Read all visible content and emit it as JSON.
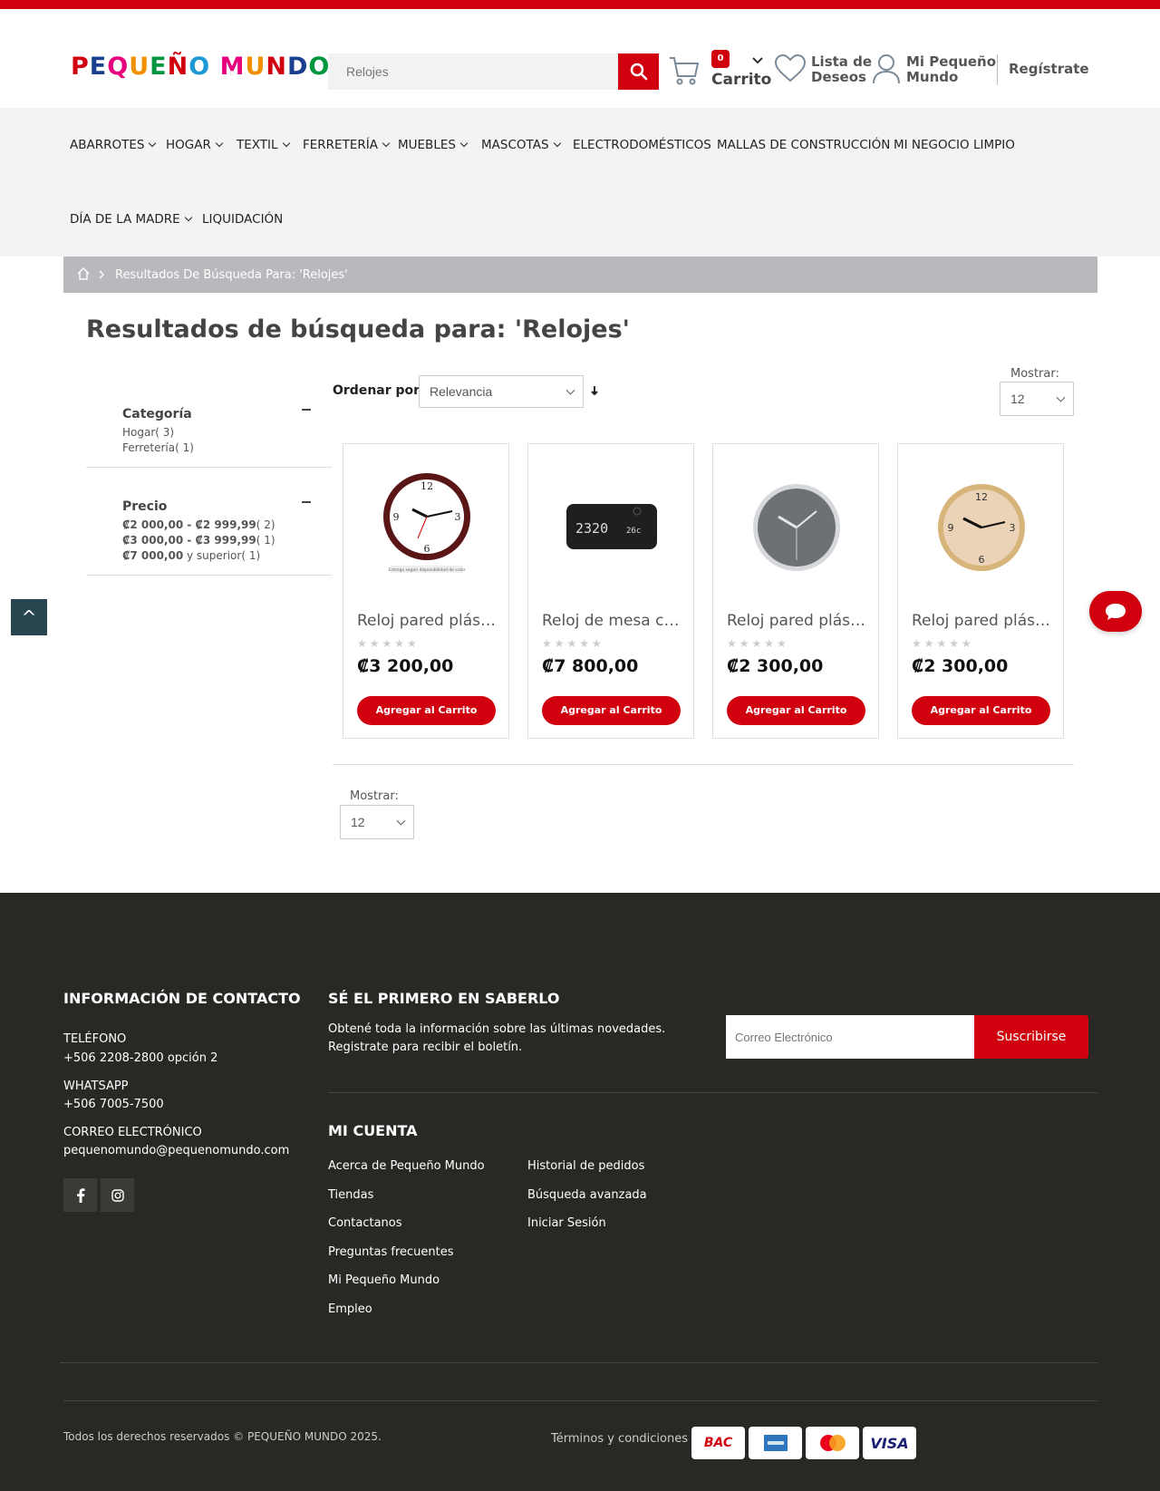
{
  "header": {
    "logo_letters": [
      {
        "ch": "P",
        "color": "#d0000f"
      },
      {
        "ch": "E",
        "color": "#1b3f8f"
      },
      {
        "ch": "Q",
        "color": "#e6007e"
      },
      {
        "ch": "U",
        "color": "#f29100"
      },
      {
        "ch": "E",
        "color": "#009640"
      },
      {
        "ch": "Ñ",
        "color": "#d0000f"
      },
      {
        "ch": "O",
        "color": "#1b9ad6"
      },
      {
        "ch": " ",
        "color": "#000"
      },
      {
        "ch": "M",
        "color": "#e6007e"
      },
      {
        "ch": "U",
        "color": "#f29100"
      },
      {
        "ch": "N",
        "color": "#d0000f"
      },
      {
        "ch": "D",
        "color": "#1b3f8f"
      },
      {
        "ch": "O",
        "color": "#009640"
      }
    ],
    "logo_text": "PEQUEÑO MUNDO",
    "search_value": "Relojes",
    "cart_count": "0",
    "cart_label": "Carrito",
    "wishlist_label": "Lista de Deseos",
    "account_label": "Mi Pequeño Mundo",
    "register_label": "Regístrate"
  },
  "nav": {
    "items": [
      {
        "label": "ABARROTES",
        "dropdown": true
      },
      {
        "label": "HOGAR",
        "dropdown": true
      },
      {
        "label": "TEXTIL",
        "dropdown": true
      },
      {
        "label": "FERRETERÍA",
        "dropdown": true
      },
      {
        "label": "MUEBLES",
        "dropdown": true
      },
      {
        "label": "MASCOTAS",
        "dropdown": true
      },
      {
        "label": "ELECTRODOMÉSTICOS",
        "dropdown": false
      },
      {
        "label": "MALLAS DE CONSTRUCCIÓN",
        "dropdown": false
      },
      {
        "label": "MI NEGOCIO LIMPIO",
        "dropdown": false
      },
      {
        "label": "DÍA DE LA MADRE",
        "dropdown": true
      },
      {
        "label": "LIQUIDACIÓN",
        "dropdown": false
      }
    ]
  },
  "breadcrumb": {
    "current": "Resultados De Búsqueda Para: 'Relojes'"
  },
  "page": {
    "title": "Resultados de búsqueda para: 'Relojes'"
  },
  "filters": {
    "category": {
      "title": "Categoría",
      "items": [
        "Hogar( 3)",
        "Ferretería( 1)"
      ]
    },
    "price": {
      "title": "Precio",
      "items": [
        {
          "range": "₡2 000,00 - ₡2 999,99",
          "count": "( 2)"
        },
        {
          "range": "₡3 000,00 - ₡3 999,99",
          "count": "( 1)"
        },
        {
          "range": "₡7 000,00",
          "suffix": " y superior",
          "count": "( 1)"
        }
      ]
    }
  },
  "toolbar": {
    "sort_label": "Ordenar por:",
    "sort_value": "Relevancia",
    "show_label": "Mostrar:",
    "show_value": "12"
  },
  "products": [
    {
      "name": "Reloj pared plástico",
      "price": "₡3 200,00",
      "button": "Agregar al Carrito",
      "image": "wall-clock-brown-icon"
    },
    {
      "name": "Reloj de mesa con",
      "price": "₡7 800,00",
      "button": "Agregar al Carrito",
      "image": "desk-clock-black-icon"
    },
    {
      "name": "Reloj pared plástico",
      "price": "₡2 300,00",
      "button": "Agregar al Carrito",
      "image": "wall-clock-gray-icon"
    },
    {
      "name": "Reloj pared plástico",
      "price": "₡2 300,00",
      "button": "Agregar al Carrito",
      "image": "wall-clock-wood-icon"
    }
  ],
  "clock_display": {
    "time": "2320",
    "temp": "26c"
  },
  "clock_tag": "Entrega según disponibilidad de color",
  "footer": {
    "contact_heading": "INFORMACIÓN DE CONTACTO",
    "phone_label": "TELÉFONO",
    "phone_value": "+506 2208-2800 opción 2",
    "whatsapp_label": "WHATSAPP",
    "whatsapp_value": "+506 7005-7500",
    "email_label": "CORREO ELECTRÓNICO",
    "email_value": "pequenomundo@pequenomundo.com",
    "news_heading": "SÉ EL PRIMERO EN SABERLO",
    "news_text_1": "Obtené toda la información sobre las últimas novedades.",
    "news_text_2": "Registrate para recibir el boletín.",
    "news_placeholder": "Correo Electrónico",
    "news_button": "Suscribirse",
    "account_heading": "MI CUENTA",
    "links_col1": [
      "Acerca de Pequeño Mundo",
      "Tiendas",
      "Contactanos",
      "Preguntas frecuentes",
      "Mi Pequeño Mundo",
      "Empleo"
    ],
    "links_col2": [
      "Historial de pedidos",
      "Búsqueda avanzada",
      "Iniciar Sesión"
    ],
    "copyright": "Todos los derechos reservados © PEQUEÑO MUNDO 2025.",
    "terms": "Términos y condiciones",
    "payments": [
      "BAC",
      "American Express",
      "Mastercard",
      "VISA"
    ]
  },
  "colors": {
    "accent": "#d0000f",
    "footer_bg": "#282825",
    "nav_bg": "#f3f3f3"
  }
}
